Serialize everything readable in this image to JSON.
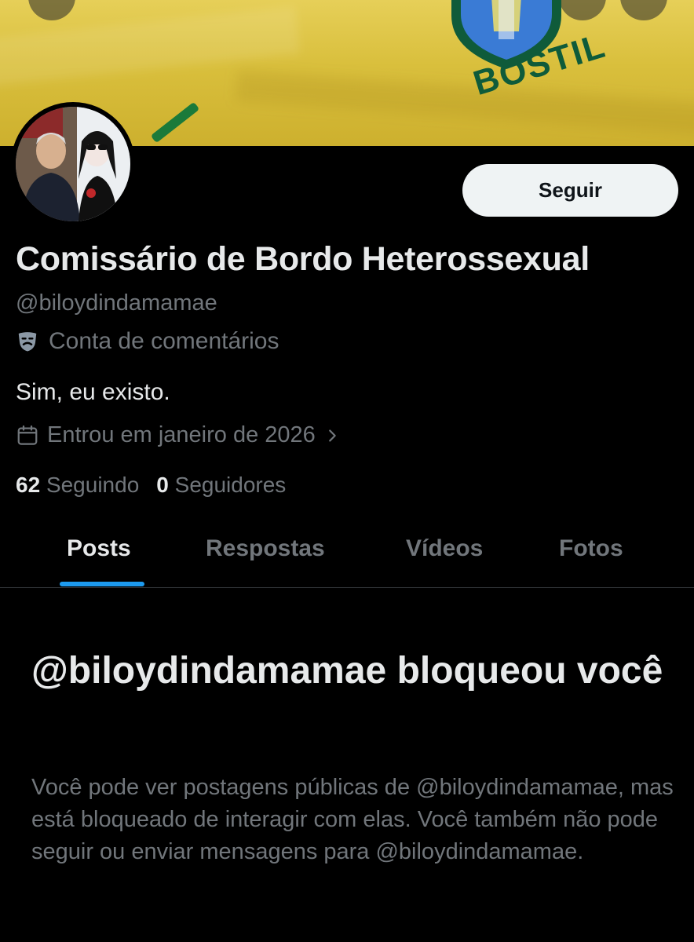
{
  "banner": {
    "crest_text": "BOSTIL",
    "colors": {
      "shirt": "#dcc445",
      "crest_green": "#0f5b3a",
      "crest_blue": "#3a7bd5"
    }
  },
  "profile": {
    "display_name": "Comissário de Bordo Heterossexual",
    "handle": "@biloydindamamae",
    "label": "Conta de comentários",
    "bio": "Sim, eu existo.",
    "joined": "Entrou em janeiro de 2026",
    "following_count": "62",
    "following_label": "Seguindo",
    "followers_count": "0",
    "followers_label": "Seguidores"
  },
  "actions": {
    "follow_label": "Seguir"
  },
  "tabs": [
    {
      "label": "Posts",
      "active": true
    },
    {
      "label": "Respostas",
      "active": false
    },
    {
      "label": "Vídeos",
      "active": false
    },
    {
      "label": "Fotos",
      "active": false
    }
  ],
  "blocked": {
    "title": "@biloydindamamae bloqueou você",
    "body": "Você pode ver postagens públicas de @biloydindamamae, mas está bloqueado de interagir com elas. Você também não pode seguir ou enviar mensagens para @biloydindamamae."
  },
  "icons": {
    "label_icon": "theater-mask-icon",
    "joined_icon": "calendar-icon",
    "joined_chevron": "chevron-right-icon"
  },
  "theme": {
    "background": "#000000",
    "primary_text": "#e7e9ea",
    "secondary_text": "#71767b",
    "accent": "#1d9bf0",
    "button_bg": "#eff3f4",
    "divider": "#2f3336"
  }
}
